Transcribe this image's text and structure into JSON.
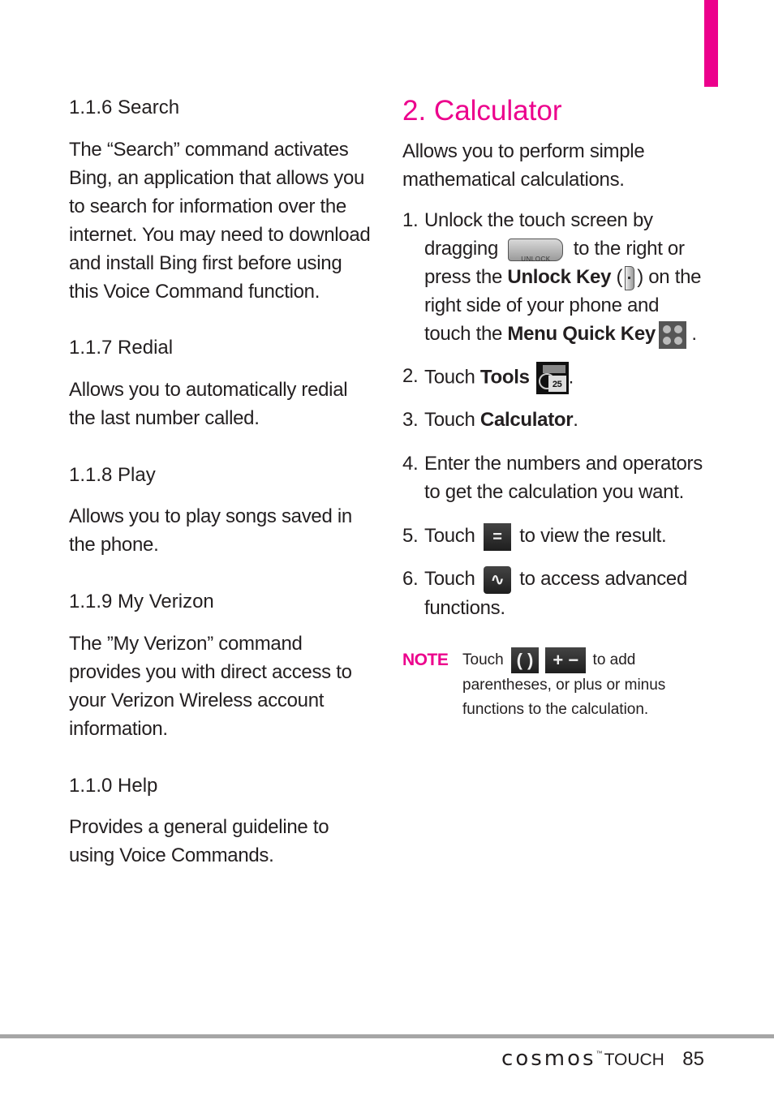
{
  "left_column": {
    "sections": [
      {
        "heading": "1.1.6 Search",
        "body": "The “Search” command activates Bing, an application that allows you to search for information over the internet. You may need to download and install Bing first before using this Voice Command function."
      },
      {
        "heading": "1.1.7 Redial",
        "body": "Allows you to automatically redial the last number called."
      },
      {
        "heading": "1.1.8 Play",
        "body": "Allows you to play songs saved in the phone."
      },
      {
        "heading": "1.1.9 My Verizon",
        "body": "The ”My Verizon” command provides you with direct access to your Verizon Wireless account information."
      },
      {
        "heading": "1.1.0 Help",
        "body": "Provides a general guideline to using Voice Commands."
      }
    ]
  },
  "right_column": {
    "title": "2. Calculator",
    "intro": "Allows you to perform simple mathematical calculations.",
    "steps": [
      {
        "num": "1.",
        "parts": [
          "Unlock the touch screen by dragging",
          "to the right or press the",
          "Unlock Key",
          "(",
          ") on the right side of your phone and touch the",
          "Menu Quick Key",
          "."
        ],
        "icons": {
          "unlock_slider_label": "UNLOCK"
        }
      },
      {
        "num": "2.",
        "parts": [
          "Touch",
          "Tools",
          "."
        ],
        "icons": {
          "tools_date": "25"
        }
      },
      {
        "num": "3.",
        "parts": [
          "Touch",
          "Calculator",
          "."
        ]
      },
      {
        "num": "4.",
        "parts": [
          "Enter the numbers and operators to get the calculation you want."
        ]
      },
      {
        "num": "5.",
        "parts": [
          "Touch",
          "to view the result."
        ],
        "icons": {
          "equals_glyph": "="
        }
      },
      {
        "num": "6.",
        "parts": [
          "Touch",
          "to access advanced functions."
        ],
        "icons": {
          "advanced_glyph": "∿"
        }
      }
    ],
    "note": {
      "label": "NOTE",
      "parts": [
        "Touch",
        "to add parentheses, or plus or minus functions to the calculation."
      ],
      "icons": {
        "parentheses_glyph": "( )",
        "plus_minus_glyph": "+ −"
      }
    }
  },
  "footer": {
    "brand": "cosmos",
    "trademark": "™",
    "brand_suffix": "TOUCH",
    "page_number": "85"
  },
  "colors": {
    "accent": "#ec008c",
    "rule": "#a6a6a6",
    "text": "#231f20"
  }
}
